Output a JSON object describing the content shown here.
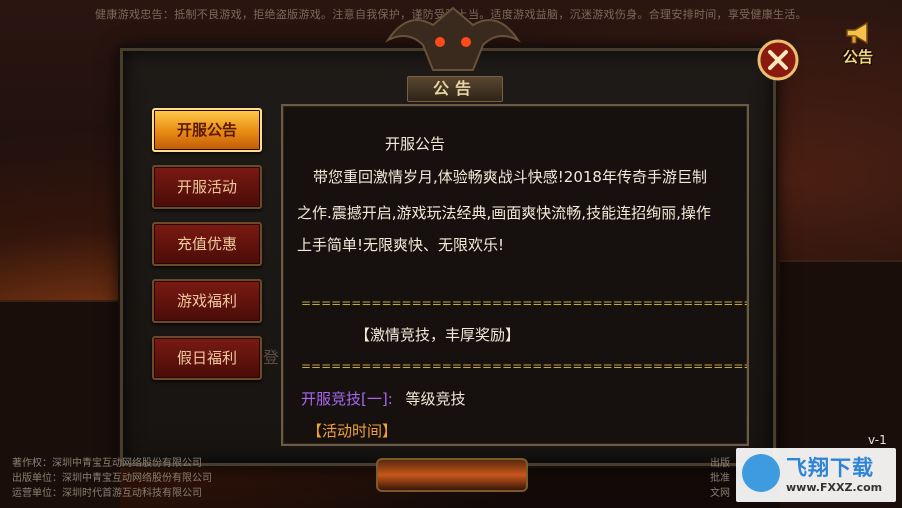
{
  "top_notice": "健康游戏忠告：抵制不良游戏，拒绝盗版游戏。注意自我保护，谨防受骗上当。适度游戏益脑，沉迷游戏伤身。合理安排时间，享受健康生活。",
  "notice_button": {
    "label": "公告",
    "icon": "horn-icon"
  },
  "dialog": {
    "title": "公告",
    "close_icon": "close-icon"
  },
  "tabs": [
    {
      "label": "开服公告",
      "active": true
    },
    {
      "label": "开服活动",
      "active": false
    },
    {
      "label": "充值优惠",
      "active": false
    },
    {
      "label": "游戏福利",
      "active": false
    },
    {
      "label": "假日福利",
      "active": false
    }
  ],
  "ghost_text": "登",
  "content": {
    "heading": "开服公告",
    "line1": "带您重回激情岁月,体验畅爽战斗快感!2018年传奇手游巨制",
    "line2": "之作.震撼开启,游戏玩法经典,画面爽快流畅,技能连招绚丽,操作",
    "line3": "上手简单!无限爽快、无限欢乐!",
    "separator": "=================================================",
    "section_title": "【激情竞技，丰厚奖励】",
    "activity_label": "开服竞技[一]:",
    "activity_value": "等级竞技",
    "time_label": "【活动时间】"
  },
  "version": "v-1",
  "footer_left": {
    "line1": "著作权：深圳中青宝互动网络股份有限公司",
    "line2": "出版单位：深圳中青宝互动网络股份有限公司",
    "line3": "运营单位：深圳时代首游互动科技有限公司"
  },
  "footer_right": {
    "line1": "出版",
    "line2": "批准",
    "line3": "文网"
  },
  "watermark": {
    "name": "飞翔下载",
    "url": "www.FXXZ.com"
  },
  "colors": {
    "accent_gold": "#ffcb4a",
    "tab_red": "#7a1a12",
    "purple_text": "#a868f0",
    "orange_text": "#f3a23a"
  }
}
